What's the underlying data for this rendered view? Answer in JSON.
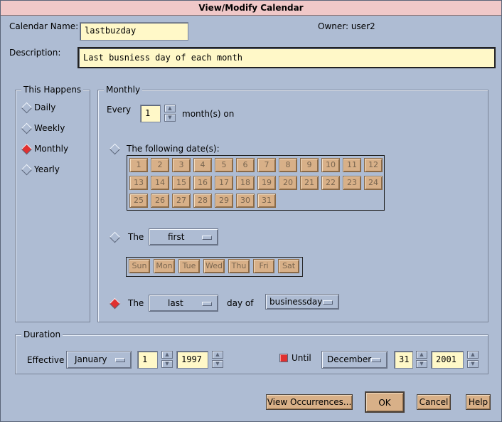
{
  "window": {
    "title": "View/Modify Calendar"
  },
  "calendar": {
    "name_label": "Calendar Name:",
    "name_value": "lastbuzday",
    "owner_label": "Owner: user2"
  },
  "description": {
    "label": "Description:",
    "value": "Last busniess day of each month"
  },
  "this_happens": {
    "title": "This Happens",
    "options": [
      "Daily",
      "Weekly",
      "Monthly",
      "Yearly"
    ],
    "selected": "Monthly"
  },
  "monthly": {
    "title": "Monthly",
    "every_label": "Every",
    "every_value": "1",
    "months_on_label": "month(s) on",
    "following_label": "The following date(s):",
    "dates": [
      "1",
      "2",
      "3",
      "4",
      "5",
      "6",
      "7",
      "8",
      "9",
      "10",
      "11",
      "12",
      "13",
      "14",
      "15",
      "16",
      "17",
      "18",
      "19",
      "20",
      "21",
      "22",
      "23",
      "24",
      "25",
      "26",
      "27",
      "28",
      "29",
      "30",
      "31"
    ],
    "the_label": "The",
    "first_value": "first",
    "weekdays": [
      "Sun",
      "Mon",
      "Tue",
      "Wed",
      "Thu",
      "Fri",
      "Sat"
    ],
    "the2_label": "The",
    "last_value": "last",
    "day_of_label": "day of",
    "businessday_value": "businessday"
  },
  "duration": {
    "title": "Duration",
    "effective_label": "Effective",
    "effective_month": "January",
    "effective_day": "1",
    "effective_year": "1997",
    "until_label": "Until",
    "until_month": "December",
    "until_day": "31",
    "until_year": "2001"
  },
  "buttons": {
    "view_occurrences": "View Occurrences...",
    "ok": "OK",
    "cancel": "Cancel",
    "help": "Help"
  },
  "colors": {
    "background": "#aebcd3",
    "title_bar": "#f0c8c8",
    "field": "#fff8c8",
    "button": "#d8b088",
    "selected_radio": "#e03030"
  }
}
